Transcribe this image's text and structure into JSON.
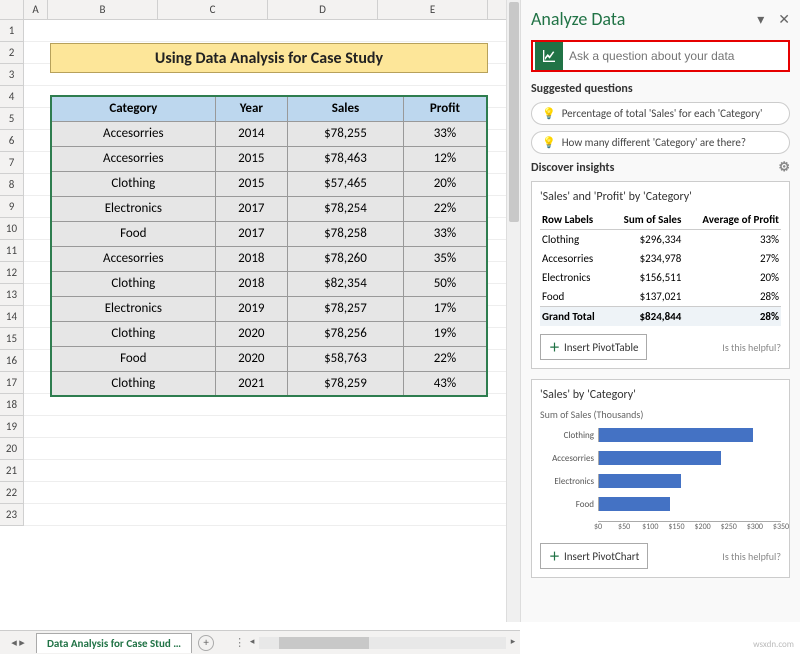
{
  "sheet": {
    "columns": [
      "A",
      "B",
      "C",
      "D",
      "E"
    ],
    "rows": [
      "1",
      "2",
      "3",
      "4",
      "5",
      "6",
      "7",
      "8",
      "9",
      "10",
      "11",
      "12",
      "13",
      "14",
      "15",
      "16",
      "17",
      "18",
      "19",
      "20",
      "21",
      "22",
      "23"
    ],
    "title": "Using Data Analysis for Case Study",
    "headers": {
      "category": "Category",
      "year": "Year",
      "sales": "Sales",
      "profit": "Profit"
    },
    "data": [
      {
        "category": "Accesorries",
        "year": "2014",
        "sales": "$78,255",
        "profit": "33%"
      },
      {
        "category": "Accesorries",
        "year": "2015",
        "sales": "$78,463",
        "profit": "12%"
      },
      {
        "category": "Clothing",
        "year": "2015",
        "sales": "$57,465",
        "profit": "20%"
      },
      {
        "category": "Electronics",
        "year": "2017",
        "sales": "$78,254",
        "profit": "22%"
      },
      {
        "category": "Food",
        "year": "2017",
        "sales": "$78,258",
        "profit": "33%"
      },
      {
        "category": "Accesorries",
        "year": "2018",
        "sales": "$78,260",
        "profit": "35%"
      },
      {
        "category": "Clothing",
        "year": "2018",
        "sales": "$82,354",
        "profit": "50%"
      },
      {
        "category": "Electronics",
        "year": "2019",
        "sales": "$78,257",
        "profit": "17%"
      },
      {
        "category": "Clothing",
        "year": "2020",
        "sales": "$78,256",
        "profit": "19%"
      },
      {
        "category": "Food",
        "year": "2020",
        "sales": "$58,763",
        "profit": "22%"
      },
      {
        "category": "Clothing",
        "year": "2021",
        "sales": "$78,259",
        "profit": "43%"
      }
    ],
    "tabName": "Data Analysis for Case Stud …"
  },
  "pane": {
    "title": "Analyze Data",
    "askPlaceholder": "Ask a question about your data",
    "suggestedLabel": "Suggested questions",
    "suggestions": [
      "Percentage of total 'Sales' for each 'Category'",
      "How many different 'Category' are there?"
    ],
    "discoverLabel": "Discover insights",
    "card1": {
      "title": "'Sales' and 'Profit' by 'Category'",
      "cols": {
        "row": "Row Labels",
        "sales": "Sum of Sales",
        "profit": "Average of Profit"
      },
      "rows": [
        {
          "label": "Clothing",
          "sales": "$296,334",
          "profit": "33%"
        },
        {
          "label": "Accesorries",
          "sales": "$234,978",
          "profit": "27%"
        },
        {
          "label": "Electronics",
          "sales": "$156,511",
          "profit": "20%"
        },
        {
          "label": "Food",
          "sales": "$137,021",
          "profit": "28%"
        }
      ],
      "total": {
        "label": "Grand Total",
        "sales": "$824,844",
        "profit": "28%"
      },
      "insert": "Insert PivotTable",
      "helpful": "Is this helpful?"
    },
    "card2": {
      "title": "'Sales' by 'Category'",
      "subtitle": "Sum of Sales (Thousands)",
      "insert": "Insert PivotChart",
      "helpful": "Is this helpful?"
    }
  },
  "chart_data": {
    "type": "bar",
    "orientation": "horizontal",
    "title": "'Sales' by 'Category'",
    "ylabel": "Sum of Sales (Thousands)",
    "categories": [
      "Clothing",
      "Accesorries",
      "Electronics",
      "Food"
    ],
    "values": [
      296,
      235,
      157,
      137
    ],
    "xlim": [
      0,
      350
    ],
    "ticks": [
      "$0",
      "$50",
      "$100",
      "$150",
      "$200",
      "$250",
      "$300",
      "$350"
    ]
  },
  "watermark": "wsxdn.com"
}
